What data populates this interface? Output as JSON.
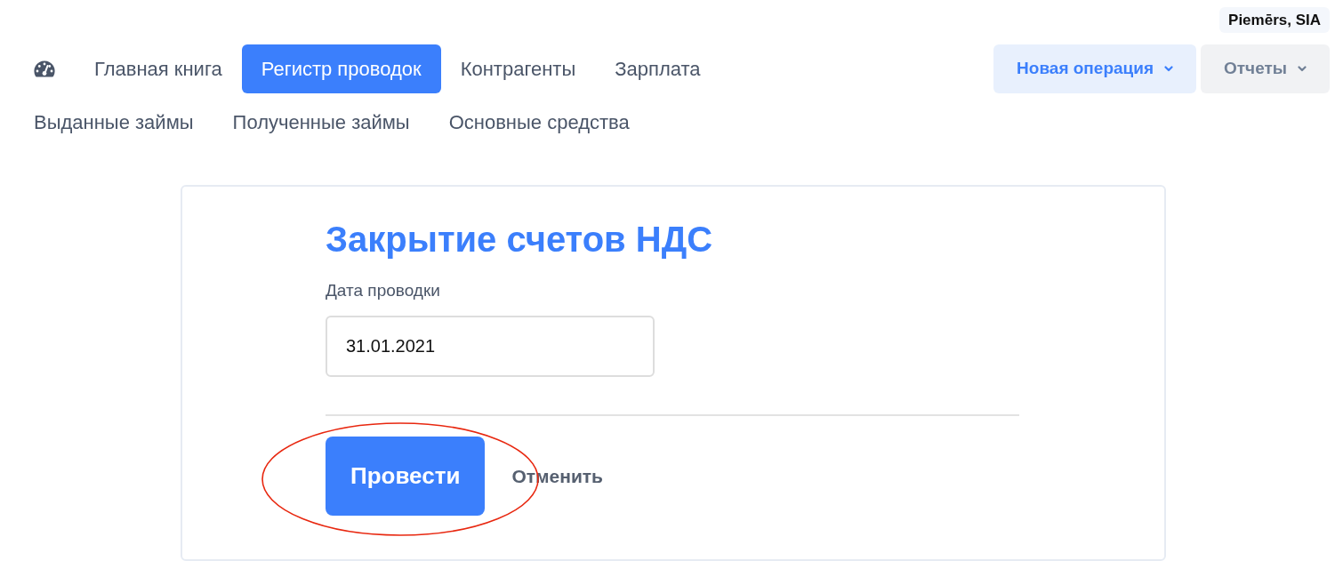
{
  "company": {
    "name": "Piemērs, SIA"
  },
  "nav_rows": [
    {
      "items": [
        {
          "label": "Главная книга",
          "selected": false
        },
        {
          "label": "Регистр проводок",
          "selected": true
        },
        {
          "label": "Контрагенты",
          "selected": false
        },
        {
          "label": "Зарплата",
          "selected": false
        }
      ]
    },
    {
      "items": [
        {
          "label": "Выданные займы",
          "selected": false
        },
        {
          "label": "Полученные займы",
          "selected": false
        },
        {
          "label": "Основные средства",
          "selected": false
        }
      ]
    }
  ],
  "actions": [
    {
      "label": "Новая операция",
      "kind": "primary",
      "dropdown": true
    },
    {
      "label": "Отчеты",
      "kind": "secondary",
      "dropdown": true
    }
  ],
  "form": {
    "title": "Закрытие счетов НДС",
    "fields": [
      {
        "label": "Дата проводки",
        "value": "31.01.2021"
      }
    ],
    "submit": {
      "label": "Провести",
      "highlighted": true
    },
    "cancel": {
      "label": "Отменить"
    }
  }
}
